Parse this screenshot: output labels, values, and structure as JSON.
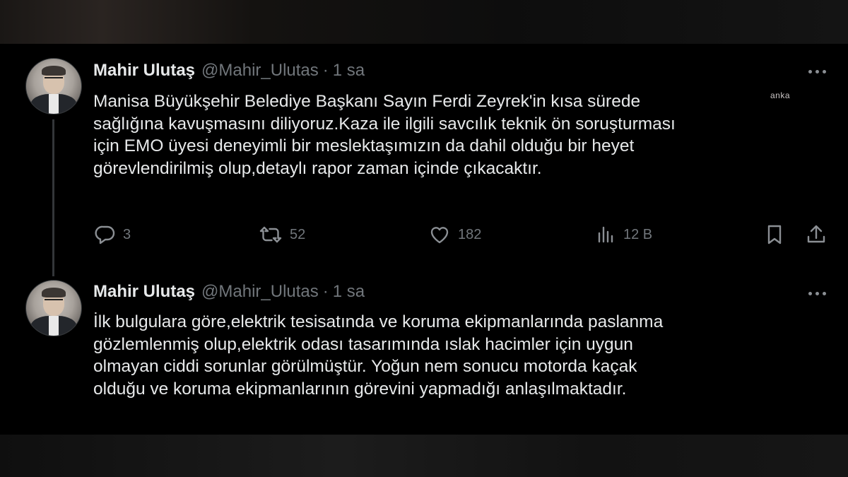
{
  "tweets": [
    {
      "author_name": "Mahir Ulutaş",
      "handle": "@Mahir_Ulutas",
      "separator": "·",
      "time": "1 sa",
      "lines": [
        "Manisa Büyükşehir Belediye Başkanı Sayın Ferdi Zeyrek'in kısa sürede",
        "sağlığına kavuşmasını diliyoruz.Kaza ile ilgili savcılık teknik ön soruşturması",
        "için EMO üyesi deneyimli bir meslektaşımızın da dahil olduğu bir heyet",
        "görevlendirilmiş olup,detaylı rapor zaman içinde çıkacaktır."
      ],
      "watermark": "anka",
      "actions": {
        "reply_count": "3",
        "retweet_count": "52",
        "like_count": "182",
        "views_count": "12 B"
      },
      "icons": [
        "reply-icon",
        "retweet-icon",
        "like-icon",
        "views-icon",
        "bookmark-icon",
        "share-icon",
        "more-icon"
      ]
    },
    {
      "author_name": "Mahir Ulutaş",
      "handle": "@Mahir_Ulutas",
      "separator": "·",
      "time": "1 sa",
      "lines": [
        "İlk bulgulara göre,elektrik tesisatında ve koruma ekipmanlarında paslanma",
        "gözlemlenmiş olup,elektrik odası tasarımında ıslak hacimler için uygun",
        "olmayan ciddi sorunlar görülmüştür. Yoğun nem sonucu motorda kaçak",
        "olduğu ve koruma ekipmanlarının görevini yapmadığı anlaşılmaktadır."
      ],
      "icons": [
        "more-icon"
      ]
    }
  ],
  "colors": {
    "background": "#000000",
    "text_primary": "#e7e9ea",
    "text_secondary": "#71767b",
    "thread_line": "#333639"
  }
}
